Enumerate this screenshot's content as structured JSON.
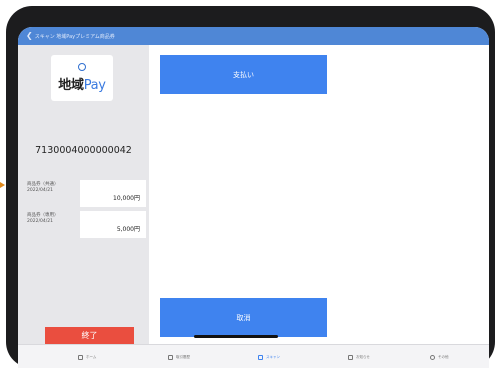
{
  "header": {
    "back_icon": "chevron-left-icon",
    "title": "スキャン 地域Payプレミアム商品券"
  },
  "sidebar": {
    "logo": {
      "mark_icon": "logo-mark-icon",
      "text_main": "地域",
      "text_pay": "Pay"
    },
    "card_number": "7130004000000042",
    "tickets": [
      {
        "label_line1": "商品券（共通）",
        "label_line2": "2022/04/21",
        "amount": "10,000円"
      },
      {
        "label_line1": "商品券（専用）",
        "label_line2": "2022/04/21",
        "amount": "5,000円"
      }
    ],
    "end_label": "終了"
  },
  "main": {
    "pay_label": "支払い",
    "cancel_label": "取消"
  },
  "tabbar": {
    "tabs": [
      {
        "icon": "home-icon",
        "label": "ホーム"
      },
      {
        "icon": "bag-icon",
        "label": "取引履歴"
      },
      {
        "icon": "scan-icon",
        "label": "スキャン"
      },
      {
        "icon": "document-icon",
        "label": "お知らせ"
      },
      {
        "icon": "more-icon",
        "label": "その他"
      }
    ],
    "active_index": 2
  },
  "colors": {
    "header": "#4f87d6",
    "primary": "#3f83ef",
    "danger": "#ea4e3f",
    "sidebar": "#e7e7ea"
  }
}
